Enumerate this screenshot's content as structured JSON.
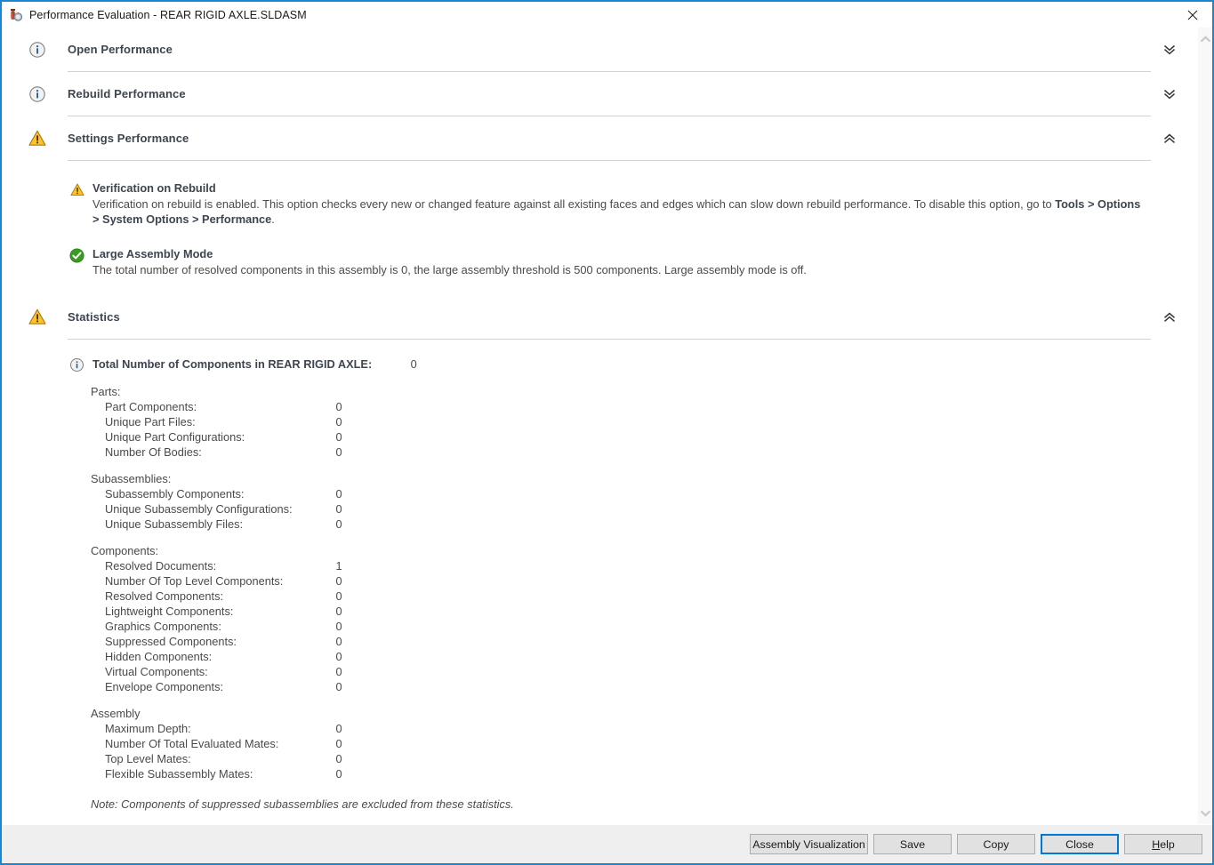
{
  "window": {
    "title": "Performance Evaluation - REAR RIGID AXLE.SLDASM",
    "icon": "stopwatch-icon",
    "close_icon": "close-icon",
    "accent_color": "#1787d4"
  },
  "scrollbar": {
    "up_icon": "chevron-up-icon",
    "down_icon": "chevron-down-icon"
  },
  "sections": [
    {
      "title": "Open Performance",
      "status_icon": "info-icon",
      "toggle_icon": "double-chevron-down-icon",
      "expanded": false
    },
    {
      "title": "Rebuild Performance",
      "status_icon": "info-icon",
      "toggle_icon": "double-chevron-down-icon",
      "expanded": false
    },
    {
      "title": "Settings Performance",
      "status_icon": "warning-icon",
      "toggle_icon": "double-chevron-up-icon",
      "expanded": true
    },
    {
      "title": "Statistics",
      "status_icon": "warning-icon",
      "toggle_icon": "double-chevron-up-icon",
      "expanded": true
    }
  ],
  "settings_performance": {
    "messages": [
      {
        "icon": "warning-icon",
        "title": "Verification on Rebuild",
        "body_part1": "Verification on rebuild is enabled. This option checks every new or changed feature against all existing faces and edges which can slow down rebuild performance. To disable this option, go to ",
        "body_bold1": "Tools > Options > System Options > Performance",
        "body_part2": "."
      },
      {
        "icon": "success-icon",
        "title": "Large Assembly Mode",
        "body_part1": "The total number of resolved components in this assembly is 0, the large assembly threshold is 500 components. Large assembly mode is off.",
        "body_bold1": "",
        "body_part2": ""
      }
    ]
  },
  "statistics": {
    "icon": "info-icon",
    "total_label": "Total Number of Components in REAR RIGID AXLE:",
    "total_value": "0",
    "groups": [
      {
        "label": "Parts:",
        "rows": [
          {
            "label": "Part Components:",
            "value": "0"
          },
          {
            "label": "Unique Part Files:",
            "value": "0"
          },
          {
            "label": "Unique Part Configurations:",
            "value": "0"
          },
          {
            "label": "Number Of Bodies:",
            "value": "0"
          }
        ]
      },
      {
        "label": "Subassemblies:",
        "rows": [
          {
            "label": "Subassembly Components:",
            "value": "0"
          },
          {
            "label": "Unique Subassembly Configurations:",
            "value": "0"
          },
          {
            "label": "Unique Subassembly Files:",
            "value": "0"
          }
        ]
      },
      {
        "label": "Components:",
        "rows": [
          {
            "label": "Resolved Documents:",
            "value": "1"
          },
          {
            "label": "Number Of Top Level Components:",
            "value": "0"
          },
          {
            "label": "Resolved Components:",
            "value": "0"
          },
          {
            "label": "Lightweight Components:",
            "value": "0"
          },
          {
            "label": "Graphics Components:",
            "value": "0"
          },
          {
            "label": "Suppressed Components:",
            "value": "0"
          },
          {
            "label": "Hidden Components:",
            "value": "0"
          },
          {
            "label": "Virtual Components:",
            "value": "0"
          },
          {
            "label": "Envelope Components:",
            "value": "0"
          }
        ]
      },
      {
        "label": "Assembly",
        "rows": [
          {
            "label": "Maximum Depth:",
            "value": "0"
          },
          {
            "label": "Number Of Total Evaluated Mates:",
            "value": "0"
          },
          {
            "label": "Top Level Mates:",
            "value": "0"
          },
          {
            "label": "Flexible Subassembly Mates:",
            "value": "0"
          }
        ]
      }
    ],
    "note": "Note: Components of suppressed subassemblies are excluded from these statistics."
  },
  "footer": {
    "buttons": [
      {
        "label": "Assembly Visualization",
        "focused": false,
        "accel": ""
      },
      {
        "label": "Save",
        "focused": false,
        "accel": ""
      },
      {
        "label": "Copy",
        "focused": false,
        "accel": ""
      },
      {
        "label": "Close",
        "focused": true,
        "accel": ""
      },
      {
        "label": "Help",
        "focused": false,
        "accel": "H"
      }
    ]
  }
}
